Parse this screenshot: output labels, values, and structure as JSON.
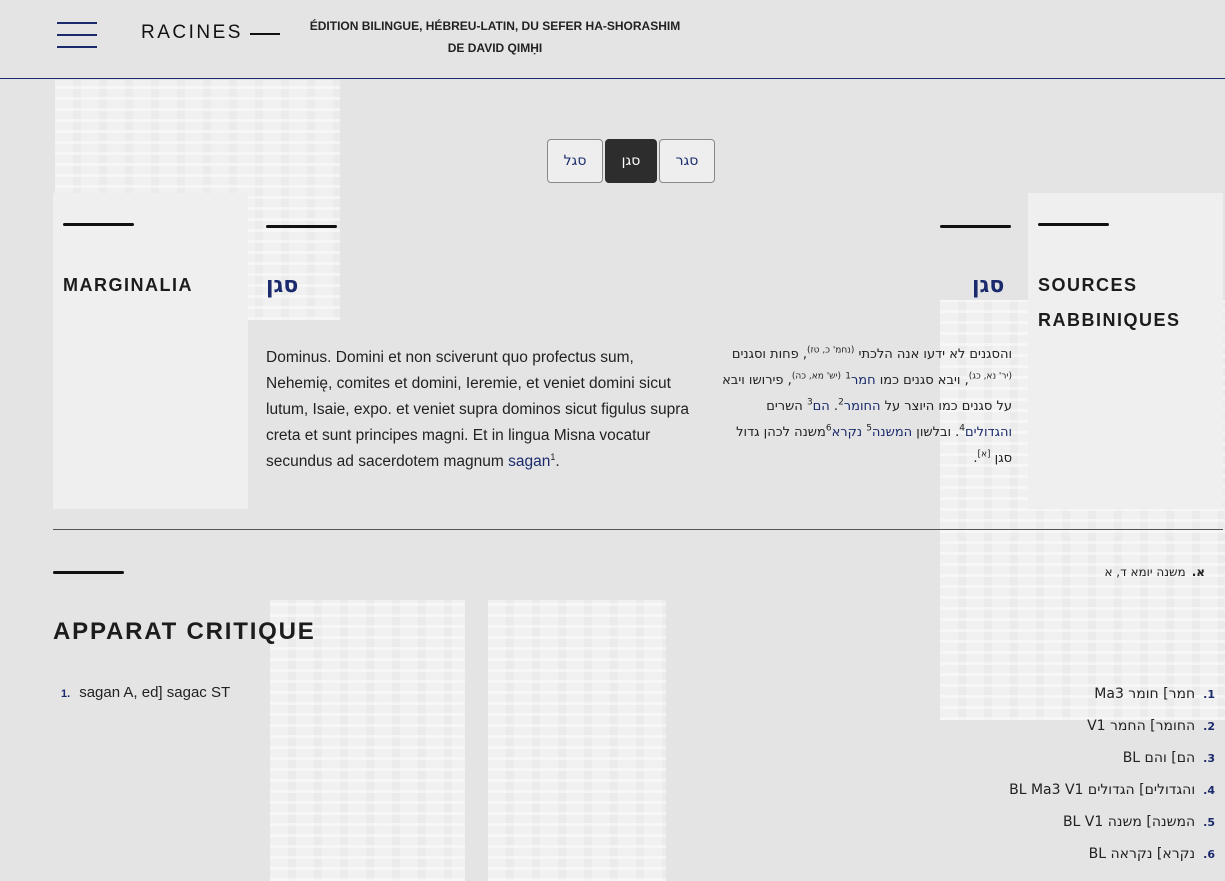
{
  "header": {
    "logo": "RACINES",
    "subtitle_line1": "ÉDITION BILINGUE, HÉBREU-LATIN, DU SEFER HA-SHORASHIM",
    "subtitle_line2": "DE DAVID QIMḤI"
  },
  "root_nav": [
    {
      "label": "סגל",
      "active": false
    },
    {
      "label": "סגן",
      "active": true
    },
    {
      "label": "סגר",
      "active": false
    }
  ],
  "marginalia": {
    "title": "MARGINALIA"
  },
  "sources": {
    "title_line1": "SOURCES",
    "title_line2": "RABBINIQUES",
    "items": [
      {
        "marker": "א.",
        "text": "משנה יומא ד, א"
      }
    ]
  },
  "latin": {
    "title": "סגן",
    "text": "Dominus. Domini et non sciverunt quo profectus sum, Nehemię, comites et domini, Ieremie, et veniet domini sicut lutum, Isaie, expo. et veniet supra dominos sicut figulus supra creta et sunt principes magni. Et in lingua Misna vocatur secundus ad sacerdotem magnum",
    "link": "sagan",
    "note": "1",
    "end": "."
  },
  "hebrew": {
    "title": "סגן",
    "p1": "והסגנים לא ידעו אנה הלכתי ",
    "ref1": "(נחמ' כ, טז)",
    "p2": ", פחות וסגנים ",
    "ref2": "(יר' נא, כג)",
    "p3": ", ויבא סגנים כמו ",
    "w1": "חמר",
    "n1": "1",
    "ref3": "(יש' מא, כה)",
    "p4": ", פירושו ויבא על סגנים כמו היוצר על ",
    "w2": "החומר",
    "n2": "2",
    "p5": ". ",
    "w3": "הם",
    "n3": "3",
    "p6": " השרים ",
    "w4": "והגדולים",
    "n4": "4",
    "p7": ". ובלשון ",
    "w5": "המשנה",
    "n5": "5",
    "p8": " ",
    "w6": "נקרא",
    "n6": "6",
    "p9": "משנה לכהן גדול סגן ",
    "n7": "[א]",
    "p10": "."
  },
  "apparatus": {
    "title": "APPARAT CRITIQUE",
    "latin": [
      {
        "num": "1.",
        "text": "sagan A, ed]  sagac ST"
      }
    ],
    "hebrew": [
      {
        "num": "1.",
        "text": "חמר]  חומר Ma3"
      },
      {
        "num": "2.",
        "text": "החומר]  החמר V1"
      },
      {
        "num": "3.",
        "text": "הם]  והם BL"
      },
      {
        "num": "4.",
        "text": "והגדולים]  הגדולים BL Ma3 V1"
      },
      {
        "num": "5.",
        "text": "המשנה]  משנה BL V1"
      },
      {
        "num": "6.",
        "text": "נקרא]  נקראה BL"
      }
    ]
  }
}
